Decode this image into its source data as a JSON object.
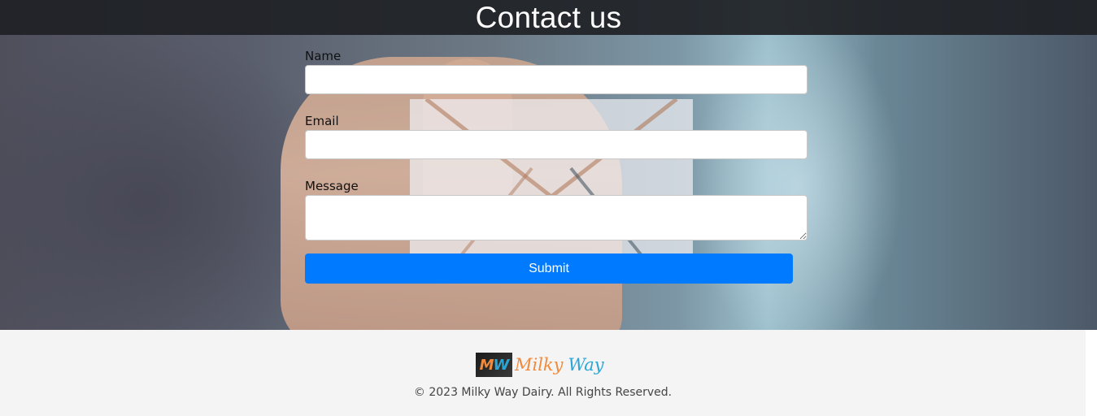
{
  "header": {
    "title": "Contact us"
  },
  "form": {
    "name_label": "Name",
    "name_value": "",
    "email_label": "Email",
    "email_value": "",
    "message_label": "Message",
    "message_value": "",
    "submit_label": "Submit"
  },
  "footer": {
    "logo_badge_m": "M",
    "logo_badge_w": "W",
    "logo_word1": "Milky",
    "logo_word2": "Way",
    "copyright": "© 2023 Milky Way Dairy. All Rights Reserved."
  },
  "colors": {
    "titlebar": "#1e2125",
    "submit": "#007bff",
    "footer_bg": "#f4f4f4",
    "logo_orange": "#f08a3c",
    "logo_blue": "#2aa6d6"
  }
}
